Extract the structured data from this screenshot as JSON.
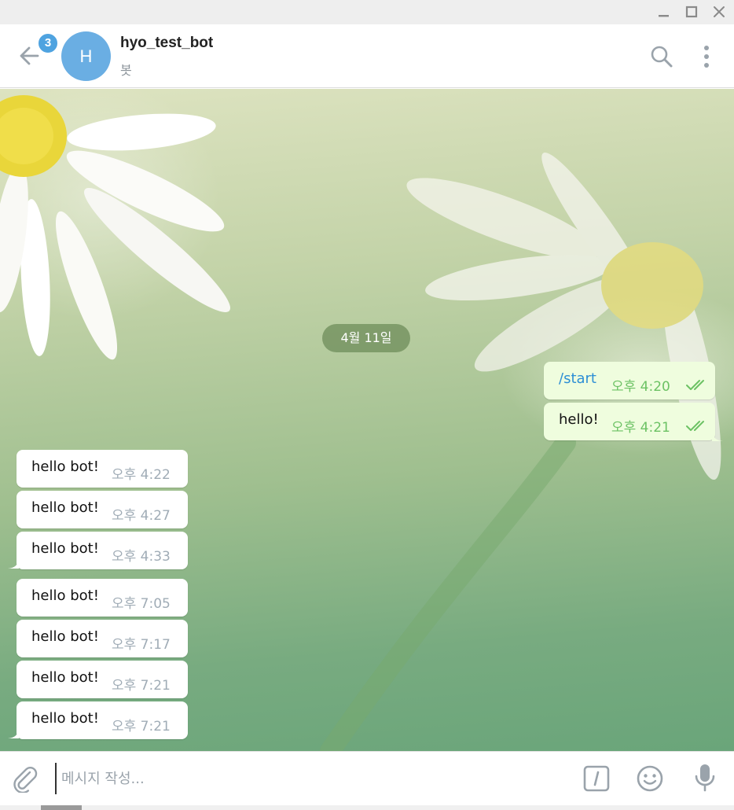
{
  "window": {
    "minimize_icon": "minimize-icon",
    "maximize_icon": "maximize-icon",
    "close_icon": "close-icon"
  },
  "header": {
    "back_icon": "arrow-left-icon",
    "unread_badge": "3",
    "avatar_letter": "H",
    "title": "hyo_test_bot",
    "subtitle": "봇",
    "search_icon": "search-icon",
    "more_icon": "more-vertical-icon"
  },
  "chat": {
    "date_divider": "4월 11일",
    "outgoing": [
      {
        "text": "/start",
        "time": "오후 4:20",
        "status": "read"
      },
      {
        "text": "hello!",
        "time": "오후 4:21",
        "status": "read"
      }
    ],
    "incoming": [
      {
        "text": "hello bot!",
        "time": "오후 4:22"
      },
      {
        "text": "hello bot!",
        "time": "오후 4:27"
      },
      {
        "text": "hello bot!",
        "time": "오후 4:33"
      },
      {
        "text": "hello bot!",
        "time": "오후 7:05"
      },
      {
        "text": "hello bot!",
        "time": "오후 7:17"
      },
      {
        "text": "hello bot!",
        "time": "오후 7:21"
      },
      {
        "text": "hello bot!",
        "time": "오후 7:21"
      }
    ]
  },
  "composer": {
    "placeholder": "메시지 작성...",
    "value": "",
    "attach_icon": "paperclip-icon",
    "command_icon": "slash-command-icon",
    "emoji_icon": "emoji-icon",
    "mic_icon": "microphone-icon"
  },
  "colors": {
    "accent": "#4fa3e0",
    "avatar": "#6aaee3",
    "outgoing_bubble": "#effdde",
    "incoming_bubble": "#ffffff",
    "read_ticks": "#6cc264",
    "command_link": "#2d8fd5"
  }
}
